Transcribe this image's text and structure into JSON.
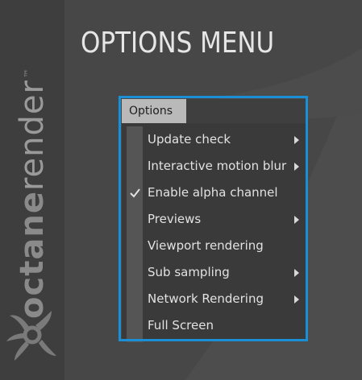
{
  "title": "OPTIONS MENU",
  "brand": {
    "wordmark_bold": "octane",
    "wordmark_light": "render",
    "trademark": "™"
  },
  "menubar": {
    "tab_label": "Options"
  },
  "menu": {
    "items": [
      {
        "label": "Update check",
        "has_submenu": true,
        "checked": false
      },
      {
        "label": "Interactive motion blur",
        "has_submenu": true,
        "checked": false
      },
      {
        "label": "Enable alpha channel",
        "has_submenu": false,
        "checked": true
      },
      {
        "label": "Previews",
        "has_submenu": true,
        "checked": false
      },
      {
        "label": "Viewport rendering",
        "has_submenu": false,
        "checked": false
      },
      {
        "label": "Sub sampling",
        "has_submenu": true,
        "checked": false
      },
      {
        "label": "Network Rendering",
        "has_submenu": true,
        "checked": false
      },
      {
        "label": "Full Screen",
        "has_submenu": false,
        "checked": false
      }
    ]
  },
  "colors": {
    "background": "#474747",
    "highlight_frame": "#1a8fd6",
    "menu_tab_active": "#b9b9b9",
    "menu_background": "#3a3a3a",
    "menu_text": "#e2e2e2"
  },
  "icons": {
    "submenu": "chevron-right-icon",
    "checked": "checkmark-icon",
    "logo": "octane-logo-icon"
  }
}
